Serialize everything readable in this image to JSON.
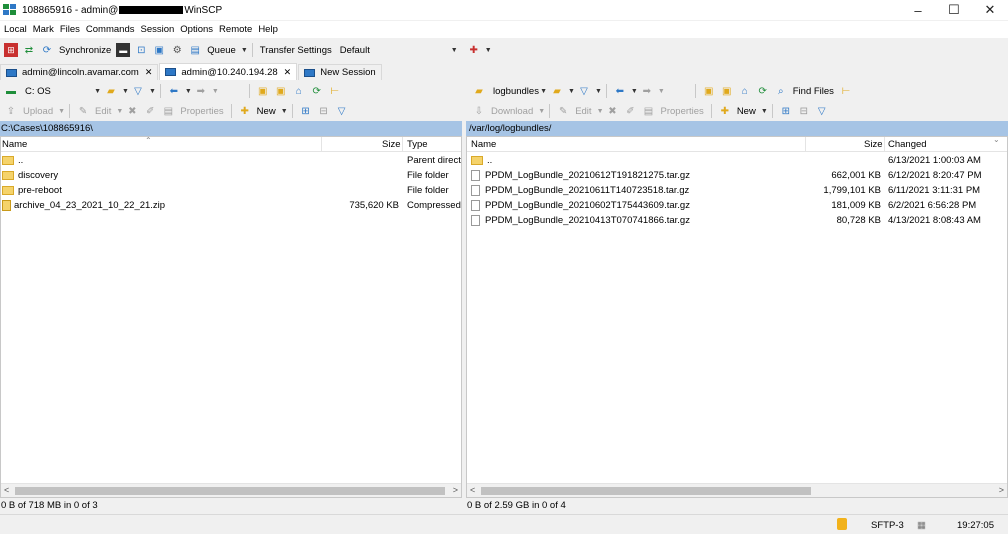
{
  "window": {
    "title_prefix": "108865916 - admin@",
    "title_suffix": "WinSCP",
    "minimize": "–",
    "maximize": "☐",
    "close": "✕"
  },
  "menu": [
    "Local",
    "Mark",
    "Files",
    "Commands",
    "Session",
    "Options",
    "Remote",
    "Help"
  ],
  "toolbar": {
    "synchronize": "Synchronize",
    "queue": "Queue",
    "transfer_settings_label": "Transfer Settings",
    "transfer_settings_value": "Default"
  },
  "tabs": [
    {
      "label": "admin@lincoln.avamar.com",
      "close": "✕"
    },
    {
      "label": "admin@10.240.194.28",
      "close": "✕"
    },
    {
      "label": "New Session"
    }
  ],
  "left": {
    "drive": "C: OS",
    "upload": "Upload",
    "edit": "Edit",
    "properties": "Properties",
    "new": "New",
    "path": "C:\\Cases\\108865916\\",
    "columns": {
      "name": "Name",
      "size": "Size",
      "type": "Type"
    },
    "rows": [
      {
        "name": "..",
        "size": "",
        "type": "Parent direct"
      },
      {
        "name": "discovery",
        "size": "",
        "type": "File folder"
      },
      {
        "name": "pre-reboot",
        "size": "",
        "type": "File folder"
      },
      {
        "name": "archive_04_23_2021_10_22_21.zip",
        "size": "735,620 KB",
        "type": "Compressed"
      }
    ],
    "status": "0 B of 718 MB in 0 of 3"
  },
  "right": {
    "folder": "logbundles",
    "find_files": "Find Files",
    "download": "Download",
    "edit": "Edit",
    "properties": "Properties",
    "new": "New",
    "path": "/var/log/logbundles/",
    "columns": {
      "name": "Name",
      "size": "Size",
      "changed": "Changed"
    },
    "rows": [
      {
        "name": "..",
        "size": "",
        "changed": "6/13/2021 1:00:03 AM"
      },
      {
        "name": "PPDM_LogBundle_20210612T191821275.tar.gz",
        "size": "662,001 KB",
        "changed": "6/12/2021 8:20:47 PM"
      },
      {
        "name": "PPDM_LogBundle_20210611T140723518.tar.gz",
        "size": "1,799,101 KB",
        "changed": "6/11/2021 3:11:31 PM"
      },
      {
        "name": "PPDM_LogBundle_20210602T175443609.tar.gz",
        "size": "181,009 KB",
        "changed": "6/2/2021 6:56:28 PM"
      },
      {
        "name": "PPDM_LogBundle_20210413T070741866.tar.gz",
        "size": "80,728 KB",
        "changed": "4/13/2021 8:08:43 AM"
      }
    ],
    "status": "0 B of 2.59 GB in 0 of 4"
  },
  "statusbar": {
    "protocol": "SFTP-3",
    "time": "19:27:05"
  },
  "colors": {
    "path_bar": "#a6c4e5",
    "folder": "#f5d36b"
  }
}
